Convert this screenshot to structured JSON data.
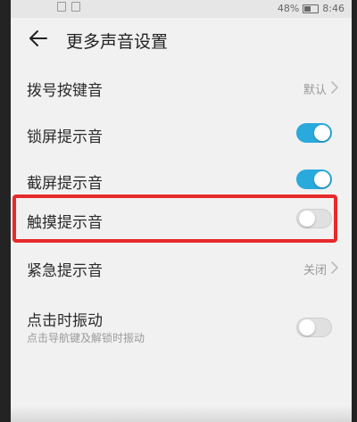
{
  "status_bar": {
    "battery": "48%",
    "time": "8:46"
  },
  "header": {
    "title": "更多声音设置",
    "back_icon": "arrow-left-icon"
  },
  "rows": [
    {
      "label": "拨号按键音",
      "value": "默认",
      "type": "link"
    },
    {
      "label": "锁屏提示音",
      "type": "toggle",
      "state": "on"
    },
    {
      "label": "截屏提示音",
      "type": "toggle",
      "state": "on"
    },
    {
      "label": "触摸提示音",
      "type": "toggle",
      "state": "off"
    },
    {
      "label": "紧急提示音",
      "value": "关闭",
      "type": "link"
    },
    {
      "label": "点击时振动",
      "sublabel": "点击导航键及解锁时振动",
      "type": "toggle",
      "state": "off"
    }
  ],
  "colors": {
    "toggle_on": "#2aa9dc",
    "highlight": "#e82a2a"
  }
}
